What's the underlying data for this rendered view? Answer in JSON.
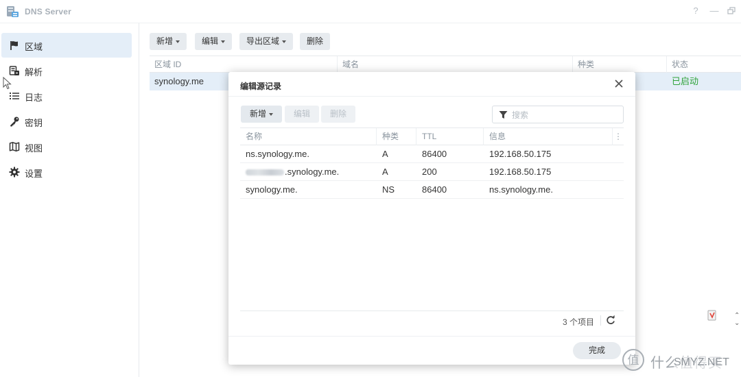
{
  "window": {
    "title": "DNS Server",
    "controls": {
      "help": "?",
      "minimize": "—"
    }
  },
  "sidebar": {
    "items": [
      {
        "label": "区域",
        "icon": "flag-icon",
        "active": true
      },
      {
        "label": "解析",
        "icon": "resolve-icon",
        "active": false
      },
      {
        "label": "日志",
        "icon": "list-icon",
        "active": false
      },
      {
        "label": "密钥",
        "icon": "key-icon",
        "active": false
      },
      {
        "label": "视图",
        "icon": "map-icon",
        "active": false
      },
      {
        "label": "设置",
        "icon": "gear-icon",
        "active": false
      }
    ]
  },
  "toolbar": {
    "add": "新增",
    "edit": "编辑",
    "export": "导出区域",
    "delete": "删除"
  },
  "zones_table": {
    "columns": [
      "区域 ID",
      "域名",
      "种类",
      "状态"
    ],
    "rows": [
      {
        "zone_id": "synology.me",
        "domain": "",
        "type": "",
        "status": "已启动"
      }
    ]
  },
  "dialog": {
    "title": "编辑源记录",
    "toolbar": {
      "add": "新增",
      "edit": "编辑",
      "delete": "删除"
    },
    "search": {
      "placeholder": "搜索",
      "value": ""
    },
    "columns": [
      "名称",
      "种类",
      "TTL",
      "信息"
    ],
    "records": [
      {
        "name": "ns.synology.me.",
        "type": "A",
        "ttl": "86400",
        "info": "192.168.50.175"
      },
      {
        "name": ".synology.me.",
        "type": "A",
        "ttl": "200",
        "info": "192.168.50.175"
      },
      {
        "name": "synology.me.",
        "type": "NS",
        "ttl": "86400",
        "info": "ns.synology.me."
      }
    ],
    "item_count": "3 个项目",
    "done": "完成"
  },
  "watermark": {
    "text": "什么值得买",
    "site": "SMYZ.NET"
  },
  "colors": {
    "accent_bg": "#e4eef8",
    "status_green": "#2fa33a",
    "button_bg": "#e7ebef"
  }
}
